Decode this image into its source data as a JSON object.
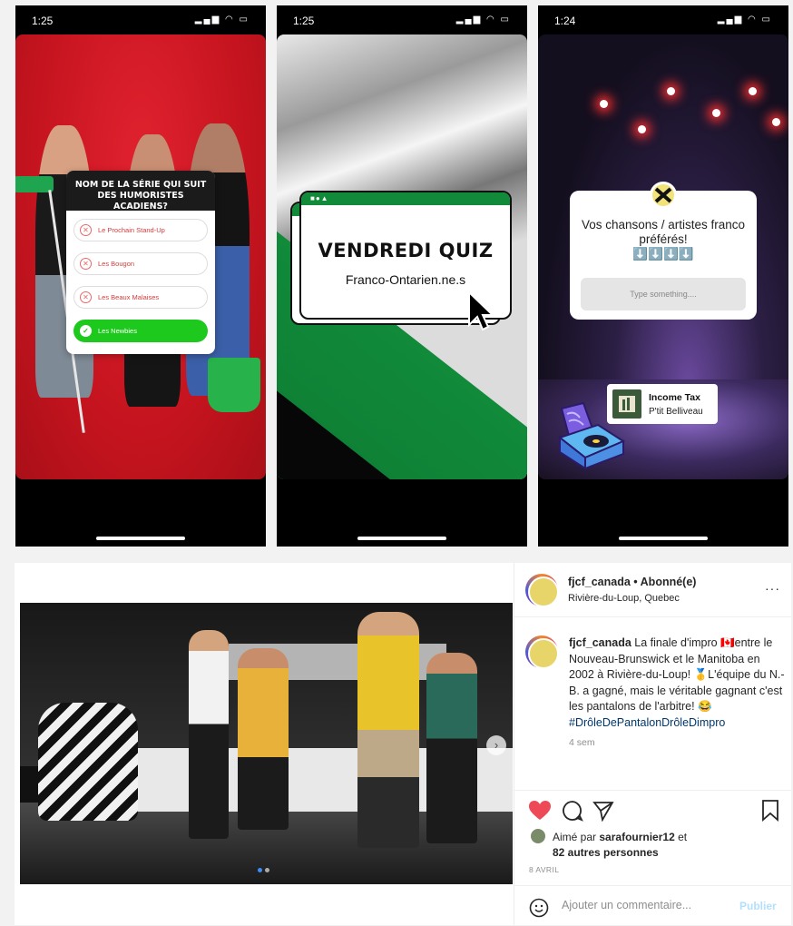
{
  "phones": [
    {
      "time": "1:25",
      "quiz": {
        "question": "NOM DE LA SÉRIE QUI SUIT DES HUMORISTES ACADIENS?",
        "options": [
          "Le Prochain Stand-Up",
          "Les Bougon",
          "Les Beaux Malaises",
          "Les Newbies"
        ],
        "correct_index": 3
      }
    },
    {
      "time": "1:25",
      "title": "VENDREDI QUIZ",
      "subtitle": "Franco-Ontarien.ne.s"
    },
    {
      "time": "1:24",
      "question": "Vos chansons / artistes franco préférés!",
      "emoji_arrows": "⬇️⬇️⬇️⬇️",
      "input_placeholder": "Type something....",
      "music": {
        "title": "Income Tax",
        "artist": "P'tit Belliveau"
      }
    }
  ],
  "post": {
    "username": "fjcf_canada",
    "follow_status": "• Abonné(e)",
    "location": "Rivière-du-Loup, Quebec",
    "caption_user": "fjcf_canada",
    "caption_text": "La finale d'impro 🇨🇦entre le Nouveau-Brunswick et le Manitoba en 2002 à Rivière-du-Loup! 🥇L'équipe du N.-B. a gagné, mais le véritable gagnant c'est les pantalons de l'arbitre! 😂",
    "hashtag": "#DrôleDePantalonDrôleDimpro",
    "time_ago": "4 sem",
    "liked_by_prefix": "Aimé par",
    "liked_by_user": "sarafournier12",
    "liked_by_suffix": "et",
    "others": "82 autres personnes",
    "date": "8 AVRIL",
    "comment_placeholder": "Ajouter un commentaire...",
    "publish_label": "Publier"
  },
  "icons": {
    "more": "more-icon",
    "heart": "heart-icon",
    "comment": "comment-icon",
    "share": "share-icon",
    "bookmark": "bookmark-icon",
    "emoji": "emoji-icon",
    "next": "chevron-right-icon"
  },
  "colors": {
    "like_red": "#ed4956",
    "correct_green": "#1ec91e",
    "quiz_green": "#118a3a",
    "link_blue": "#0095f6"
  }
}
